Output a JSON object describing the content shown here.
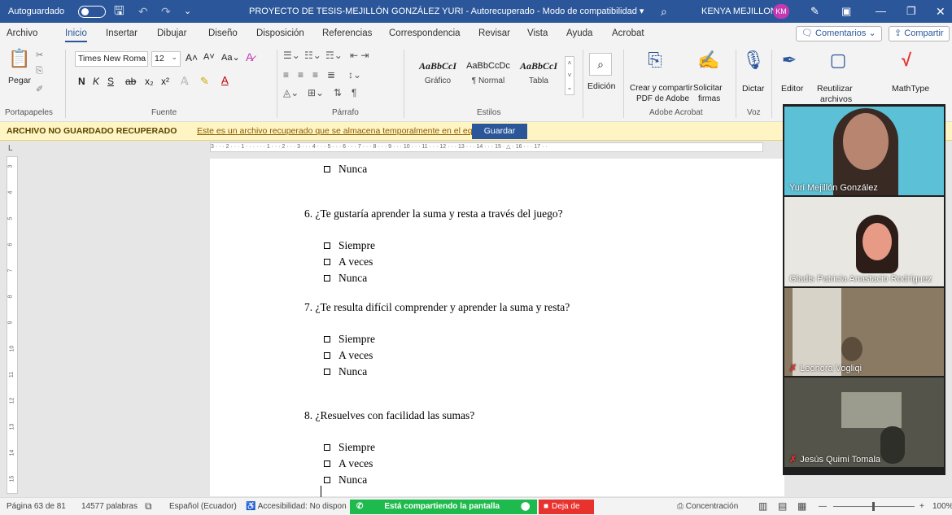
{
  "titlebar": {
    "autosave_label": "Autoguardado",
    "doc_title": "PROYECTO DE TESIS-MEJILLÓN GONZÁLEZ YURI  -  Autorecuperado  -  Modo de compatibilidad  ▾",
    "user_name": "KENYA MEJILLON",
    "user_initials": "KM"
  },
  "menu": {
    "tabs": [
      "Archivo",
      "Inicio",
      "Insertar",
      "Dibujar",
      "Diseño",
      "Disposición",
      "Referencias",
      "Correspondencia",
      "Revisar",
      "Vista",
      "Ayuda",
      "Acrobat"
    ],
    "active_tab": "Inicio",
    "comments_label": "Comentarios",
    "share_label": "Compartir"
  },
  "ribbon": {
    "clipboard": {
      "paste_label": "Pegar",
      "group_label": "Portapapeles"
    },
    "font": {
      "family": "Times New Roma",
      "size": "12",
      "group_label": "Fuente",
      "bold": "N",
      "italic": "K",
      "underline": "S"
    },
    "paragraph": {
      "group_label": "Párrafo"
    },
    "styles": {
      "group_label": "Estilos",
      "items": [
        {
          "sample": "AaBbCcI",
          "name": "Gráfico"
        },
        {
          "sample": "AaBbCcDc",
          "name": "¶ Normal"
        },
        {
          "sample": "AaBbCcI",
          "name": "Tabla"
        }
      ]
    },
    "editing": {
      "label": "Edición"
    },
    "acrobat": {
      "create_label_1": "Crear y compartir",
      "create_label_2": "PDF de Adobe",
      "request_label_1": "Solicitar",
      "request_label_2": "firmas",
      "group_label": "Adobe Acrobat"
    },
    "voice": {
      "dictate_label": "Dictar",
      "group_label": "Voz"
    },
    "editor_label": "Editor",
    "reuse_label_1": "Reutilizar",
    "reuse_label_2": "archivos",
    "mathtype_label": "MathType"
  },
  "notice": {
    "title": "ARCHIVO NO GUARDADO RECUPERADO",
    "message": "Este es un archivo recuperado que se almacena temporalmente en el equipo.",
    "save_button": "Guardar"
  },
  "ruler": {
    "text": "3 · · · 2 · · · 1 · · · · · · 1 · · · 2 · · · 3 · · · 4 · · · 5 · · · 6 · · · 7 · · · 8 · · · 9 · · · 10 · · · 11 · · · 12 · · · 13 · · · 14 · · · 15 · △ · 16 · · · 17 · ·",
    "vertical_ticks": [
      "3",
      "4",
      "5",
      "6",
      "7",
      "8",
      "9",
      "10",
      "11",
      "12",
      "13",
      "14",
      "15"
    ]
  },
  "document": {
    "lines": [
      {
        "type": "option",
        "text": "Nunca"
      },
      {
        "type": "question",
        "text": "6.   ¿Te gustaría aprender la suma y resta a través del juego?"
      },
      {
        "type": "option",
        "text": "Siempre"
      },
      {
        "type": "option",
        "text": "A veces"
      },
      {
        "type": "option",
        "text": "Nunca"
      },
      {
        "type": "question",
        "text": "7.   ¿Te resulta difícil comprender y aprender la suma y resta?"
      },
      {
        "type": "option",
        "text": "Siempre"
      },
      {
        "type": "option",
        "text": "A veces"
      },
      {
        "type": "option",
        "text": "Nunca"
      },
      {
        "type": "question",
        "text": "8.   ¿Resuelves con facilidad las sumas?"
      },
      {
        "type": "option",
        "text": "Siempre"
      },
      {
        "type": "option",
        "text": "A veces"
      },
      {
        "type": "option",
        "text": "Nunca"
      }
    ]
  },
  "participants": [
    {
      "name": "Yuri Mejillón González",
      "muted": false,
      "colors": [
        "#5cc1d6",
        "#3a2a24",
        "#b88670"
      ]
    },
    {
      "name": "Gladis Patricia Anastacio Rodríguez",
      "muted": false,
      "colors": [
        "#e9e7e2",
        "#2d1d18",
        "#e79a86"
      ]
    },
    {
      "name": "Leonora Vogliqi",
      "muted": true,
      "colors": [
        "#8a7a64",
        "#d8d3c9",
        "#5c4c3c"
      ]
    },
    {
      "name": "Jesús Quimi  Tomala",
      "muted": true,
      "colors": [
        "#54544a",
        "#9b9c8e",
        "#2f2f2a"
      ]
    }
  ],
  "status": {
    "page": "Página 63 de 81",
    "words": "14577 palabras",
    "language": "Español (Ecuador)",
    "accessibility": "Accesibilidad: No dispon",
    "sharing": "Está compartiendo la pantalla",
    "stop": "Deja de",
    "focus": "Concentración",
    "zoom": "100%"
  }
}
